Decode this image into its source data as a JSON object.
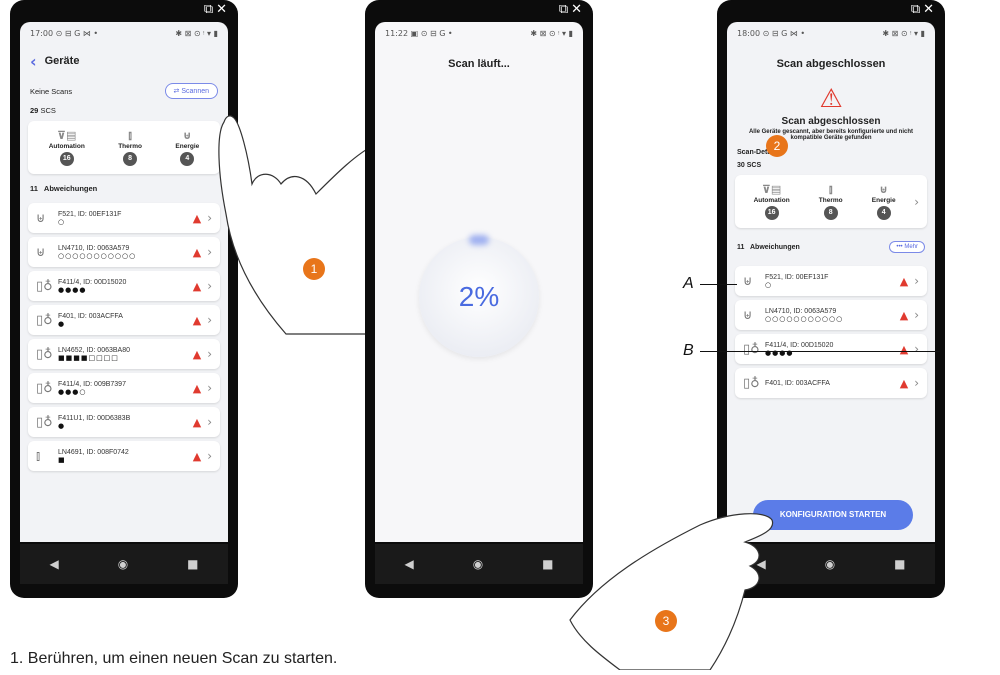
{
  "phone1": {
    "status_time": "17:00 ⊙ ⊟ G ⋈ •",
    "status_right": "✱ ⊠ ⊙ ᵎ ▾ ▮",
    "title": "Geräte",
    "no_scans": "Keine Scans",
    "scan_button": "Scannen",
    "count": "29",
    "protocol": "SCS",
    "categories": [
      {
        "label": "Automation",
        "count": "16",
        "icon": "automation-icon"
      },
      {
        "label": "Thermo",
        "count": "8",
        "icon": "thermo-icon"
      },
      {
        "label": "Energie",
        "count": "4",
        "icon": "energy-icon"
      }
    ],
    "deviations_count": "11",
    "deviations_label": "Abweichungen",
    "devices": [
      {
        "name": "F521, ID: 00EF131F",
        "dots": "○",
        "icon": "plug-icon"
      },
      {
        "name": "LN4710, ID: 0063A579",
        "dots": "○○○○○○○○○○○",
        "icon": "plug-icon"
      },
      {
        "name": "F411/4, ID: 00D15020",
        "dots": "●●●●",
        "icon": "light-icon"
      },
      {
        "name": "F401, ID: 003ACFFA",
        "dots": "●",
        "icon": "light-icon"
      },
      {
        "name": "LN4652, ID: 0063BA80",
        "dots": "■■■■□□□□",
        "icon": "light-icon"
      },
      {
        "name": "F411/4, ID: 009B7397",
        "dots": "●●●○",
        "icon": "light-icon"
      },
      {
        "name": "F411U1, ID: 00D6383B",
        "dots": "●",
        "icon": "light-icon"
      },
      {
        "name": "LN4691, ID: 008F0742",
        "dots": "■",
        "icon": "thermo-icon"
      }
    ]
  },
  "phone2": {
    "status_time": "11:22 ▣ ⊙ ⊟ G •",
    "status_right": "✱ ⊠ ⊙ ᵎ ▾ ▮",
    "title": "Scan läuft...",
    "progress_text": "2%",
    "progress": 0.02
  },
  "phone3": {
    "status_time": "18:00 ⊙ ⊟ G ⋈ •",
    "status_right": "✱ ⊠ ⊙ ᵎ ▾ ▮",
    "title": "Scan abgeschlossen",
    "result_title": "Scan abgeschlossen",
    "result_text": "Alle Geräte gescannt, aber bereits konfigurierte und nicht kompatible Geräte gefunden",
    "details_label": "Scan-Details",
    "count": "30",
    "protocol": "SCS",
    "categories": [
      {
        "label": "Automation",
        "count": "16",
        "icon": "automation-icon"
      },
      {
        "label": "Thermo",
        "count": "8",
        "icon": "thermo-icon"
      },
      {
        "label": "Energie",
        "count": "4",
        "icon": "energy-icon"
      }
    ],
    "deviations_count": "11",
    "deviations_label": "Abweichungen",
    "more_button": "••• Mehr",
    "devices": [
      {
        "name": "F521, ID: 00EF131F",
        "dots": "○",
        "icon": "plug-icon"
      },
      {
        "name": "LN4710, ID: 0063A579",
        "dots": "○○○○○○○○○○○",
        "icon": "plug-icon"
      },
      {
        "name": "F411/4, ID: 00D15020",
        "dots": "●●●●",
        "icon": "light-icon"
      },
      {
        "name": "F401, ID: 003ACFFA",
        "dots": "",
        "icon": "light-icon"
      }
    ],
    "start_button": "KONFIGURATION STARTEN"
  },
  "callouts": {
    "one": "1",
    "two": "2",
    "three": "3",
    "a": "A",
    "b": "B"
  },
  "caption": "1.   Berühren, um einen neuen Scan zu starten.",
  "colors": {
    "accent": "#5b6be0",
    "warning": "#e03a2f",
    "callout": "#e8751a",
    "button": "#5b7ce8"
  }
}
